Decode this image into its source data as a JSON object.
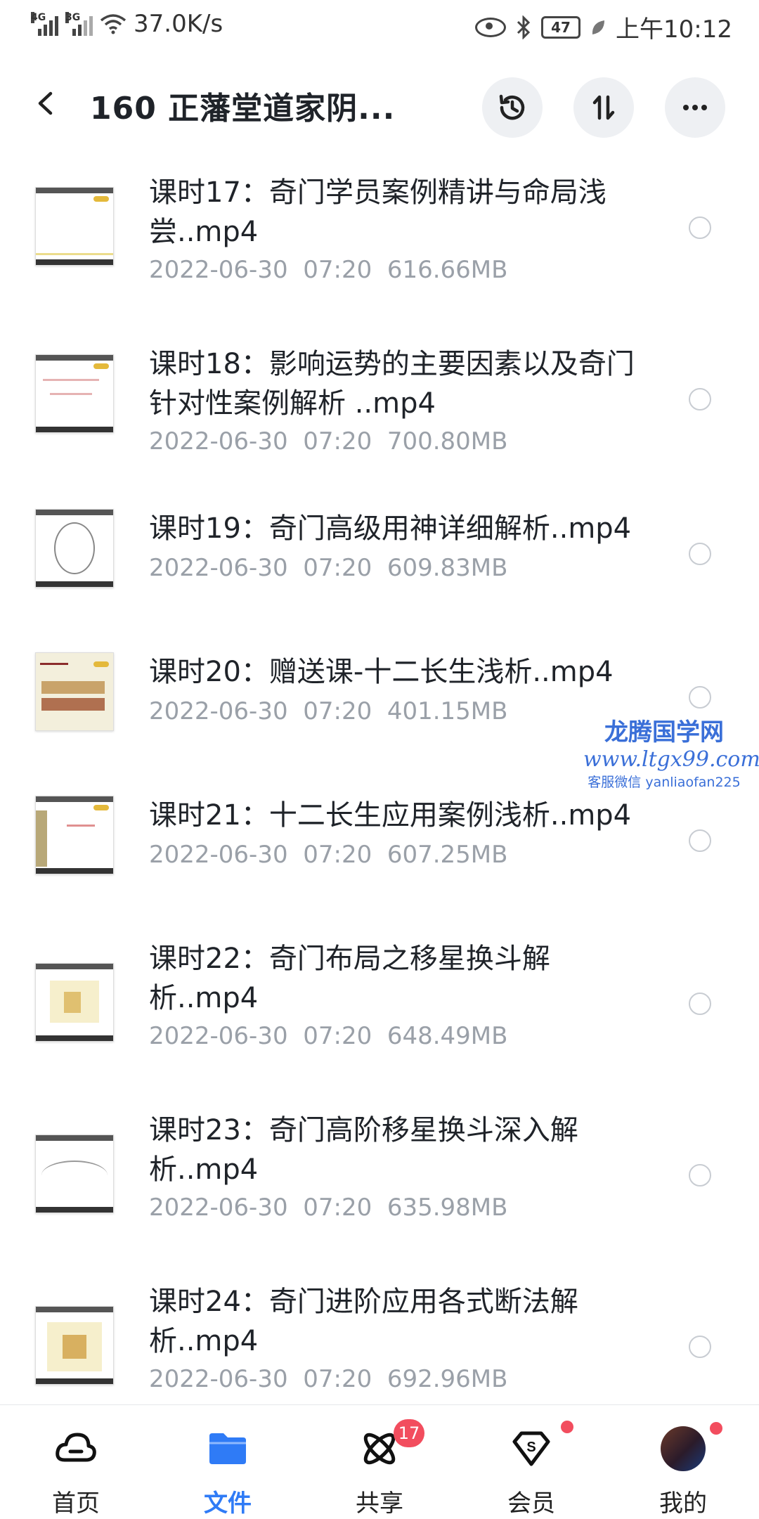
{
  "status_bar": {
    "net_left": "4G",
    "net_right": "3G",
    "speed": "37.0K/s",
    "battery": "47",
    "time": "上午10:12"
  },
  "header": {
    "title": "160 正藩堂道家阴...",
    "icons": [
      "back-arrow-icon",
      "history-icon",
      "sort-icon",
      "more-icon"
    ]
  },
  "files": [
    {
      "name": "课时17：奇门学员案例精讲与命局浅尝..mp4",
      "date": "2022-06-30",
      "time": "07:20",
      "size": "616.66MB"
    },
    {
      "name": "课时18：影响运势的主要因素以及奇门针对性案例解析 ..mp4",
      "date": "2022-06-30",
      "time": "07:20",
      "size": "700.80MB"
    },
    {
      "name": "课时19：奇门高级用神详细解析..mp4",
      "date": "2022-06-30",
      "time": "07:20",
      "size": "609.83MB"
    },
    {
      "name": "课时20：赠送课-十二长生浅析..mp4",
      "date": "2022-06-30",
      "time": "07:20",
      "size": "401.15MB"
    },
    {
      "name": "课时21：十二长生应用案例浅析..mp4",
      "date": "2022-06-30",
      "time": "07:20",
      "size": "607.25MB"
    },
    {
      "name": "课时22：奇门布局之移星换斗解析..mp4",
      "date": "2022-06-30",
      "time": "07:20",
      "size": "648.49MB"
    },
    {
      "name": "课时23：奇门高阶移星换斗深入解析..mp4",
      "date": "2022-06-30",
      "time": "07:20",
      "size": "635.98MB"
    },
    {
      "name": "课时24：奇门进阶应用各式断法解析..mp4",
      "date": "2022-06-30",
      "time": "07:20",
      "size": "692.96MB"
    }
  ],
  "watermark": {
    "line1": "龙腾国学网",
    "line2": "www.ltgx99.com",
    "line3": "客服微信 yanliaofan225"
  },
  "nav": {
    "tabs": [
      {
        "label": "首页",
        "icon": "cloud-home-icon"
      },
      {
        "label": "文件",
        "icon": "folder-icon",
        "active": true
      },
      {
        "label": "共享",
        "icon": "share-atom-icon",
        "badge": "17"
      },
      {
        "label": "会员",
        "icon": "vip-diamond-icon",
        "dot": true
      },
      {
        "label": "我的",
        "icon": "avatar",
        "dot": true
      }
    ]
  },
  "colors": {
    "accent": "#2f7bf6",
    "badge": "#f24d5e",
    "meta_text": "#9aa0a8"
  }
}
